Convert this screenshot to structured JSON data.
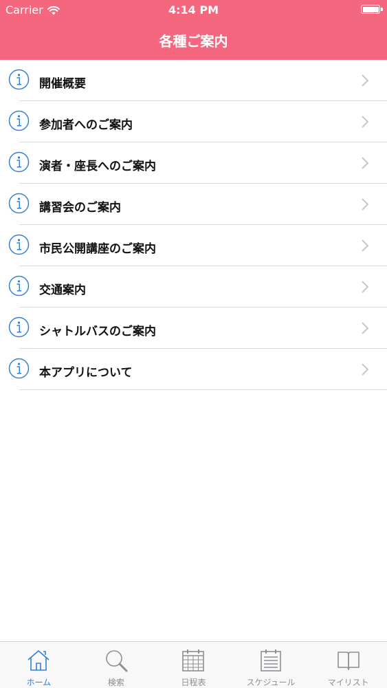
{
  "status_bar": {
    "carrier": "Carrier",
    "time": "4:14 PM",
    "battery_level": 1.0
  },
  "nav": {
    "title": "各種ご案内"
  },
  "menu": {
    "items": [
      {
        "label": "開催概要"
      },
      {
        "label": "参加者へのご案内"
      },
      {
        "label": "演者・座長へのご案内"
      },
      {
        "label": "講習会のご案内"
      },
      {
        "label": "市民公開講座のご案内"
      },
      {
        "label": "交通案内"
      },
      {
        "label": "シャトルバスのご案内"
      },
      {
        "label": "本アプリについて"
      }
    ]
  },
  "tabbar": {
    "tabs": [
      {
        "label": "ホーム",
        "icon": "home-icon",
        "active": true
      },
      {
        "label": "検索",
        "icon": "search-icon",
        "active": false
      },
      {
        "label": "日程表",
        "icon": "calendar-icon",
        "active": false
      },
      {
        "label": "スケジュール",
        "icon": "schedule-icon",
        "active": false
      },
      {
        "label": "マイリスト",
        "icon": "book-icon",
        "active": false
      }
    ]
  },
  "colors": {
    "accent": "#f4677f",
    "icon_blue": "#2f80d6",
    "tab_inactive": "#8e8e93"
  }
}
